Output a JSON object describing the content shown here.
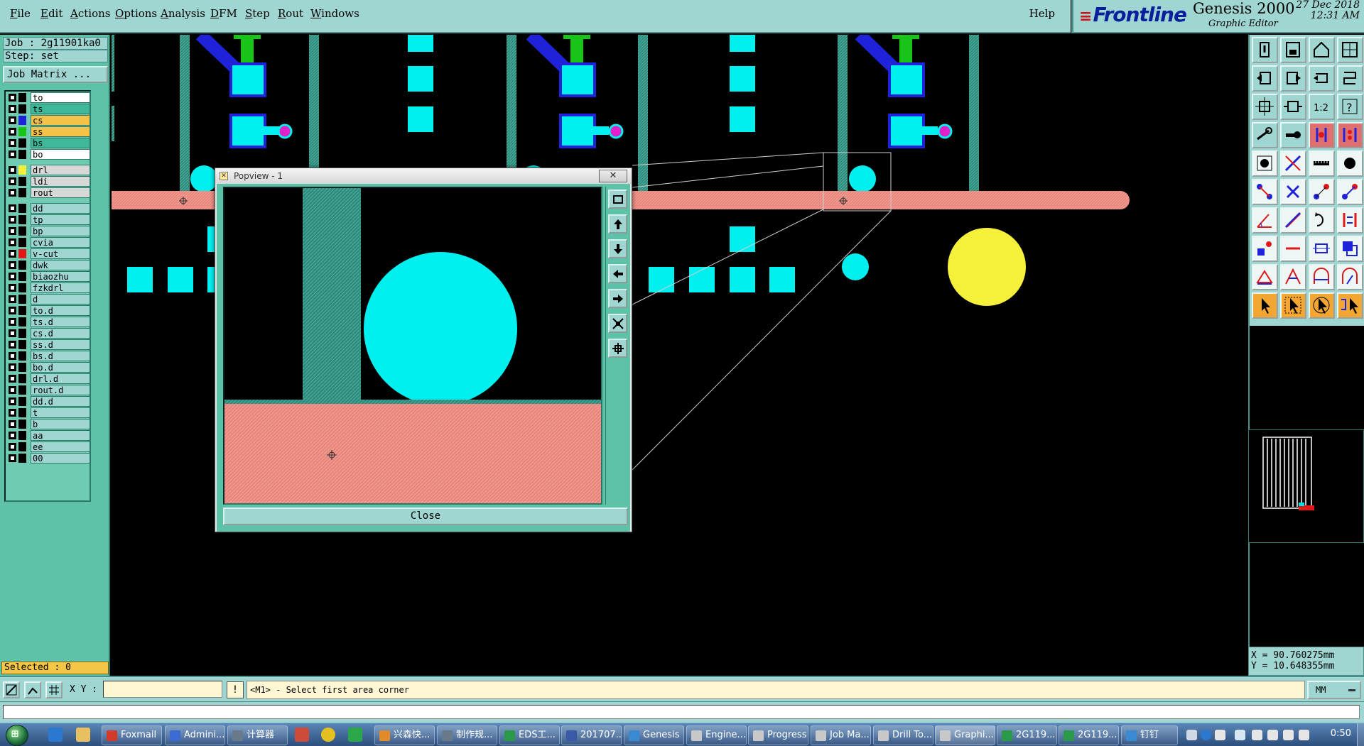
{
  "menubar": {
    "items": [
      "File",
      "Edit",
      "Actions",
      "Options",
      "Analysis",
      "DFM",
      "Step",
      "Rout",
      "Windows"
    ],
    "help": "Help"
  },
  "brand": {
    "logo": "Frontline",
    "title": "Genesis 2000",
    "subtitle": "Graphic Editor",
    "date": "27 Dec 2018",
    "time": "12:31 AM"
  },
  "job": {
    "job_line": "Job : 2g11901ka0",
    "step_line": "Step: set",
    "matrix_button": "Job Matrix ...",
    "selected": "Selected : 0"
  },
  "layers": [
    {
      "name": "to",
      "swatch": "#000000",
      "bg": "#ffffff"
    },
    {
      "name": "ts",
      "swatch": "#000000",
      "bg": "#3fb89a"
    },
    {
      "name": "cs",
      "swatch": "#1e22d8",
      "bg": "#f5c24a"
    },
    {
      "name": "ss",
      "swatch": "#19c419",
      "bg": "#f5c24a"
    },
    {
      "name": "bs",
      "swatch": "#000000",
      "bg": "#3fb89a"
    },
    {
      "name": "bo",
      "swatch": "#000000",
      "bg": "#ffffff"
    },
    {
      "name": "drl",
      "swatch": "#f5f03a",
      "bg": "#d8d8d8"
    },
    {
      "name": "ldi",
      "swatch": "#000000",
      "bg": "#d8d8d8"
    },
    {
      "name": "rout",
      "swatch": "#000000",
      "bg": "#d8d8d8"
    },
    {
      "name": "dd",
      "swatch": "#000000",
      "bg": "#9fd6d2"
    },
    {
      "name": "tp",
      "swatch": "#000000",
      "bg": "#9fd6d2"
    },
    {
      "name": "bp",
      "swatch": "#000000",
      "bg": "#9fd6d2"
    },
    {
      "name": "cvia",
      "swatch": "#000000",
      "bg": "#9fd6d2"
    },
    {
      "name": "v-cut",
      "swatch": "#e01818",
      "bg": "#9fd6d2"
    },
    {
      "name": "dwk",
      "swatch": "#000000",
      "bg": "#9fd6d2"
    },
    {
      "name": "biaozhu",
      "swatch": "#000000",
      "bg": "#9fd6d2"
    },
    {
      "name": "fzkdrl",
      "swatch": "#000000",
      "bg": "#9fd6d2"
    },
    {
      "name": "d",
      "swatch": "#000000",
      "bg": "#9fd6d2"
    },
    {
      "name": "to.d",
      "swatch": "#000000",
      "bg": "#9fd6d2"
    },
    {
      "name": "ts.d",
      "swatch": "#000000",
      "bg": "#9fd6d2"
    },
    {
      "name": "cs.d",
      "swatch": "#000000",
      "bg": "#9fd6d2"
    },
    {
      "name": "ss.d",
      "swatch": "#000000",
      "bg": "#9fd6d2"
    },
    {
      "name": "bs.d",
      "swatch": "#000000",
      "bg": "#9fd6d2"
    },
    {
      "name": "bo.d",
      "swatch": "#000000",
      "bg": "#9fd6d2"
    },
    {
      "name": "drl.d",
      "swatch": "#000000",
      "bg": "#9fd6d2"
    },
    {
      "name": "rout.d",
      "swatch": "#000000",
      "bg": "#9fd6d2"
    },
    {
      "name": "dd.d",
      "swatch": "#000000",
      "bg": "#9fd6d2"
    },
    {
      "name": "t",
      "swatch": "#000000",
      "bg": "#9fd6d2"
    },
    {
      "name": "b",
      "swatch": "#000000",
      "bg": "#9fd6d2"
    },
    {
      "name": "aa",
      "swatch": "#000000",
      "bg": "#9fd6d2"
    },
    {
      "name": "ee",
      "swatch": "#000000",
      "bg": "#9fd6d2"
    },
    {
      "name": "00",
      "swatch": "#000000",
      "bg": "#9fd6d2"
    }
  ],
  "popview": {
    "title": "Popview - 1",
    "close_x": "✕",
    "close_button": "Close"
  },
  "coords": {
    "x": "X = 90.760275mm",
    "y": "Y = 10.648355mm"
  },
  "command": {
    "xy_label": "X Y :",
    "xy_value": "",
    "prompt_icon": "!",
    "prompt": "<M1> - Select first area corner",
    "units": "MM"
  },
  "taskbar": {
    "tasks": [
      {
        "label": "Foxmail",
        "color": "#d23a2a"
      },
      {
        "label": "Admini...",
        "color": "#3a6ad2"
      },
      {
        "label": "计算器",
        "color": "#6a7a8a"
      },
      {
        "label": "兴森快...",
        "color": "#e08a2a"
      },
      {
        "label": "制作规...",
        "color": "#6a7a8a"
      },
      {
        "label": "EDS工...",
        "color": "#2a9a4a"
      },
      {
        "label": "201707...",
        "color": "#3a5aa8"
      },
      {
        "label": "Genesis",
        "color": "#3a8ad2"
      },
      {
        "label": "Engine...",
        "color": "#c8c8c8"
      },
      {
        "label": "Progress",
        "color": "#c8c8c8"
      },
      {
        "label": "Job Ma...",
        "color": "#c8c8c8"
      },
      {
        "label": "Drill To...",
        "color": "#c8c8c8"
      },
      {
        "label": "Graphi...",
        "color": "#c8c8c8"
      },
      {
        "label": "2G119...",
        "color": "#2a9a4a"
      },
      {
        "label": "2G119...",
        "color": "#2a9a4a"
      },
      {
        "label": "钉钉",
        "color": "#3a8ad2"
      }
    ],
    "clock": "0:50"
  },
  "colors": {
    "panel": "#5ec2a8",
    "panel_light": "#9fd6d2",
    "pad": "#00f0f0",
    "rout": "#e8867c",
    "trace": "#2e8a7c",
    "drill": "#f5f03a",
    "cs": "#1e22d8",
    "ss": "#19c419"
  }
}
